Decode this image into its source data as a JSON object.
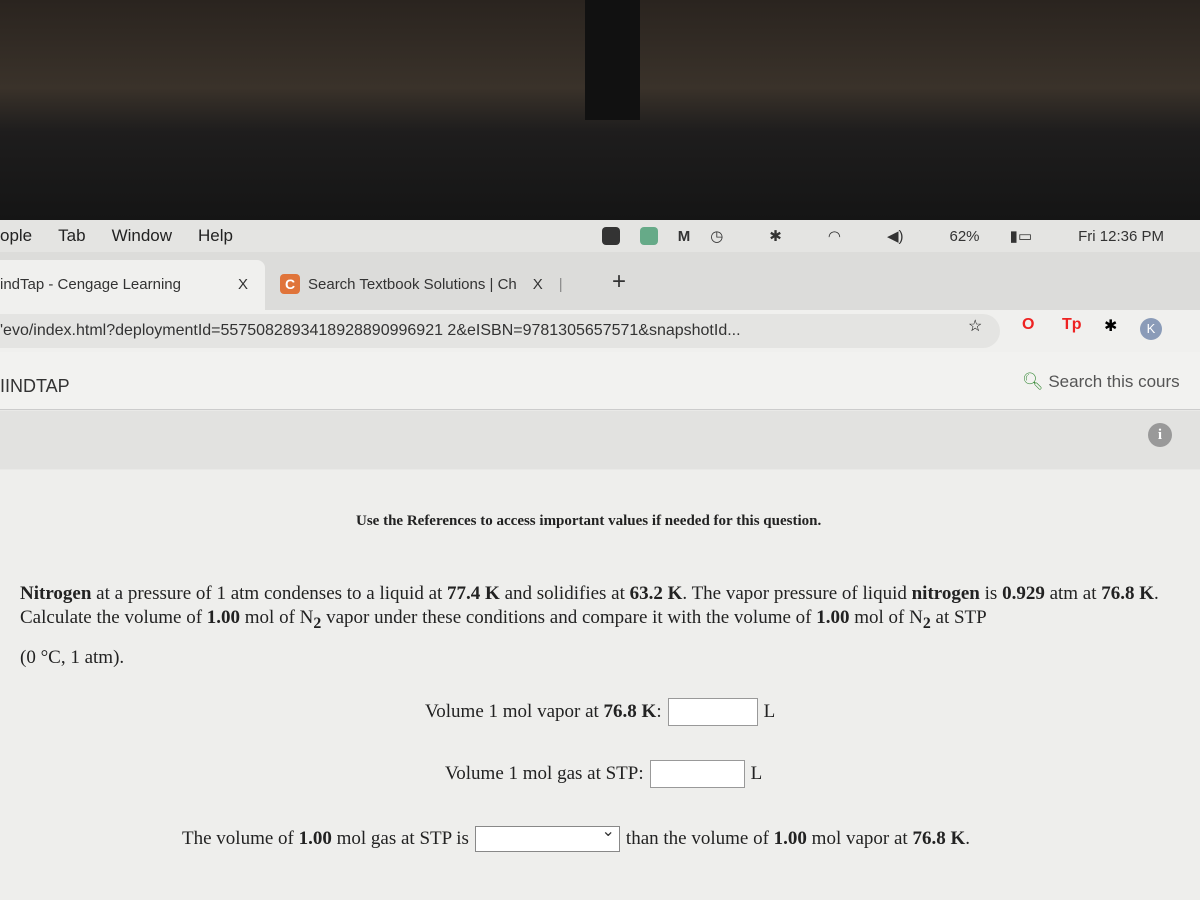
{
  "menubar": {
    "items": [
      "ople",
      "Tab",
      "Window",
      "Help"
    ],
    "battery": "62%",
    "clock": "Fri 12:36 PM"
  },
  "tabs": [
    {
      "label": "indTap - Cengage Learning",
      "close": "X"
    },
    {
      "logo": "C",
      "label": "Search Textbook Solutions | Ch",
      "close": "X"
    }
  ],
  "new_tab": "+",
  "address": {
    "url": "'evo/index.html?deploymentId=5575082893418928890996921 2&eISBN=9781305657571&snapshotId...",
    "ext_tp": "Tp",
    "avatar": "K"
  },
  "mindtap": {
    "brand": "IINDTAP",
    "search_placeholder": "Search this cours"
  },
  "content": {
    "references": "Use the References to access important values if needed for this question.",
    "q_bold1": "Nitrogen",
    "q_t1": " at a pressure of 1 atm condenses to a liquid at ",
    "q_b2": "77.4 K",
    "q_t2": " and solidifies at ",
    "q_b3": "63.2 K",
    "q_t3": ". The vapor pressure of liquid ",
    "q_b4": "nitrogen",
    "q_t4": " is ",
    "q_b5": "0.929",
    "q_t5": " atm at ",
    "q_b6": "76.8 K",
    "q_t6": ". Calculate the volume of ",
    "q_b7": "1.00",
    "q_t7": " mol of N",
    "sub": "2",
    "q_t8": " vapor under these conditions and compare it with the volume of ",
    "q_b8": "1.00",
    "q_t9": " mol of N",
    "q_t10": " at STP",
    "q_line3": "(0 °C, 1 atm).",
    "row1_label": "Volume 1 mol vapor at ",
    "row1_bold": "76.8 K",
    "row1_colon": ":",
    "unit": "L",
    "row2_label": "Volume 1 mol gas at STP:",
    "row3_pre": "The volume of ",
    "row3_b1": "1.00",
    "row3_mid": " mol gas at STP is",
    "row3_post": "than the volume of ",
    "row3_b2": "1.00",
    "row3_post2": " mol vapor at ",
    "row3_b3": "76.8 K",
    "row3_end": ".",
    "row1_value": "",
    "row2_value": "",
    "row3_selected": ""
  }
}
